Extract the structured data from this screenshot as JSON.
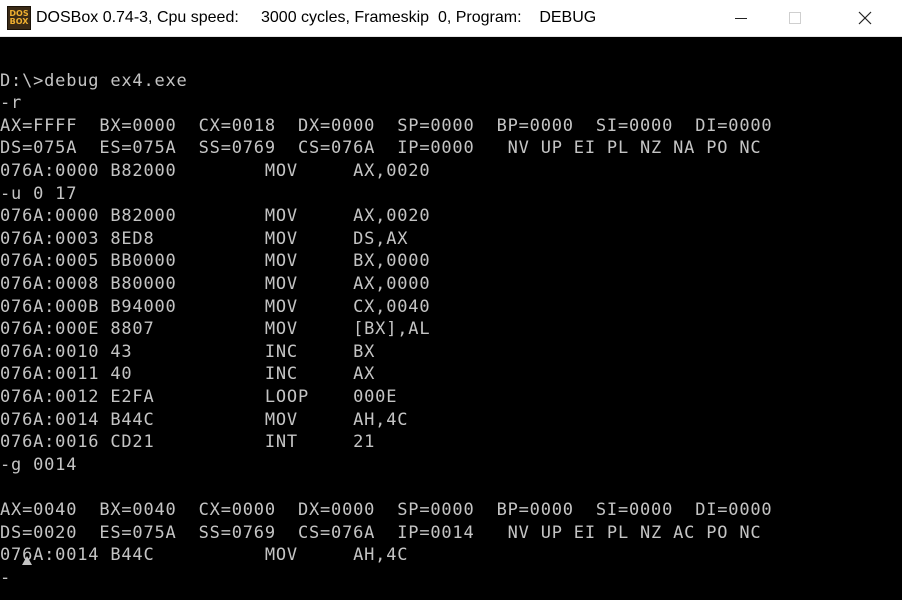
{
  "window": {
    "title": "DOSBox 0.74-3, Cpu speed:     3000 cycles, Frameskip  0, Program:    DEBUG",
    "icon_name": "dosbox-icon",
    "icon_text_top": "DOS",
    "icon_text_bottom": "BOX",
    "buttons": {
      "minimize": "minimize-icon",
      "maximize": "maximize-icon",
      "close": "close-icon"
    }
  },
  "terminal": {
    "lines": [
      "",
      "D:\\>debug ex4.exe",
      "-r",
      "AX=FFFF  BX=0000  CX=0018  DX=0000  SP=0000  BP=0000  SI=0000  DI=0000",
      "DS=075A  ES=075A  SS=0769  CS=076A  IP=0000   NV UP EI PL NZ NA PO NC",
      "076A:0000 B82000        MOV     AX,0020",
      "-u 0 17",
      "076A:0000 B82000        MOV     AX,0020",
      "076A:0003 8ED8          MOV     DS,AX",
      "076A:0005 BB0000        MOV     BX,0000",
      "076A:0008 B80000        MOV     AX,0000",
      "076A:000B B94000        MOV     CX,0040",
      "076A:000E 8807          MOV     [BX],AL",
      "076A:0010 43            INC     BX",
      "076A:0011 40            INC     AX",
      "076A:0012 E2FA          LOOP    000E",
      "076A:0014 B44C          MOV     AH,4C",
      "076A:0016 CD21          INT     21",
      "-g 0014",
      "",
      "AX=0040  BX=0040  CX=0000  DX=0000  SP=0000  BP=0000  SI=0000  DI=0000",
      "DS=0020  ES=075A  SS=0769  CS=076A  IP=0014   NV UP EI PL NZ AC PO NC",
      "076A:0014 B44C          MOV     AH,4C",
      "-"
    ],
    "text_color": "#c4c4c4",
    "background_color": "#000000"
  }
}
